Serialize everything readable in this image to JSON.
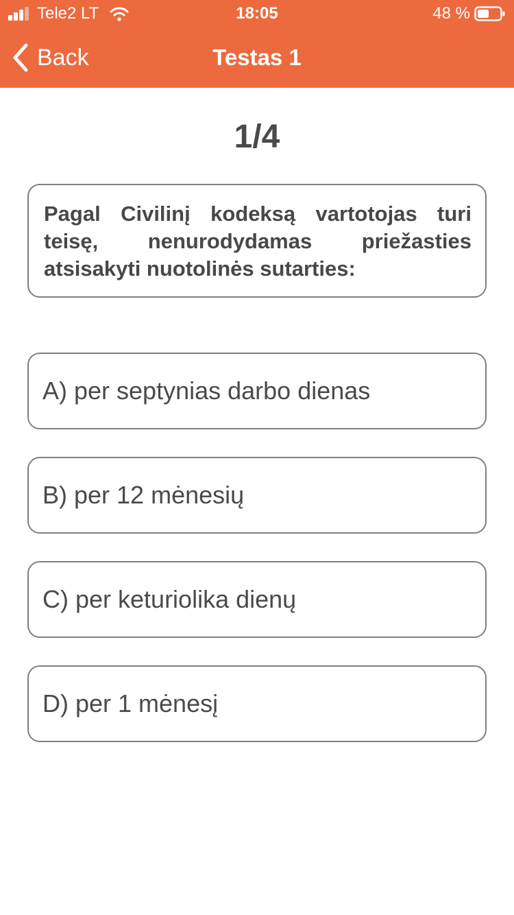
{
  "status_bar": {
    "carrier": "Tele2 LT",
    "time": "18:05",
    "battery_percent": "48 %",
    "signal_icon": "signal-bars-icon",
    "wifi_icon": "wifi-icon",
    "battery_icon": "battery-icon"
  },
  "nav": {
    "back_label": "Back",
    "back_icon": "chevron-left-icon",
    "title": "Testas 1"
  },
  "quiz": {
    "progress": "1/4",
    "question": "Pagal Civilinį kodeksą vartotojas turi teisę, nenurodydamas priežasties atsisakyti nuotolinės sutarties:",
    "answers": [
      {
        "label": "A) per septynias darbo dienas"
      },
      {
        "label": "B) per 12 mėnesių"
      },
      {
        "label": "C) per keturiolika dienų"
      },
      {
        "label": "D) per 1 mėnesį"
      }
    ]
  },
  "colors": {
    "header_bg": "#ec6a3e",
    "border": "#7f7f7f",
    "text": "#4a4a4a"
  }
}
